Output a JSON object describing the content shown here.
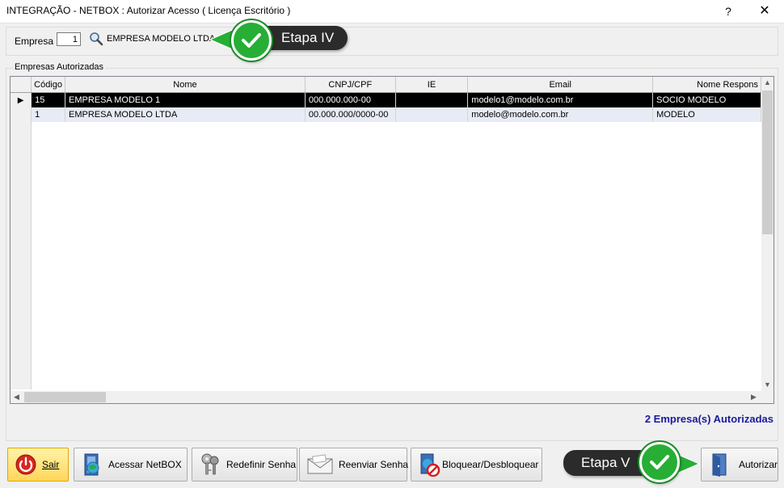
{
  "window": {
    "title": "INTEGRAÇÃO - NETBOX : Autorizar Acesso ( Licença Escritório )",
    "help_label": "?",
    "close_label": "✕"
  },
  "empresa": {
    "label": "Empresa",
    "code": "1",
    "name": "EMPRESA MODELO LTDA"
  },
  "callouts": {
    "step4": "Etapa IV",
    "step5": "Etapa V"
  },
  "group": {
    "legend": "Empresas Autorizadas"
  },
  "grid": {
    "columns": [
      "Código",
      "Nome",
      "CNPJ/CPF",
      "IE",
      "Email",
      "Nome Respons"
    ],
    "rows": [
      {
        "codigo": "15",
        "nome": "EMPRESA MODELO 1",
        "cnpj": "000.000.000-00",
        "ie": "",
        "email": "modelo1@modelo.com.br",
        "responsavel": "SOCIO MODELO"
      },
      {
        "codigo": "1",
        "nome": "EMPRESA MODELO LTDA",
        "cnpj": "00.000.000/0000-00",
        "ie": "",
        "email": "modelo@modelo.com.br",
        "responsavel": "MODELO"
      }
    ],
    "selected_row_indicator": "▶"
  },
  "status": {
    "count_text": "2 Empresa(s) Autorizadas"
  },
  "buttons": {
    "sair": "Sair",
    "acessar": "Acessar NetBOX",
    "redefinir": "Redefinir Senha",
    "reenviar": "Reenviar Senha",
    "bloquear": "Bloquear/Desbloquear",
    "autorizar": "Autorizar"
  },
  "colors": {
    "selected_row_bg": "#000000",
    "alt_row_bg": "#e7ebf5",
    "count_text": "#1a1aa0",
    "callout_bg": "#2b2b2b",
    "check_green": "#27ae35",
    "sair_bg": "#ffd65c"
  },
  "icons": [
    "search-icon",
    "check-icon",
    "power-icon",
    "globe-door-icon",
    "keys-icon",
    "envelope-icon",
    "block-icon",
    "door-icon",
    "close-icon",
    "help-icon"
  ]
}
